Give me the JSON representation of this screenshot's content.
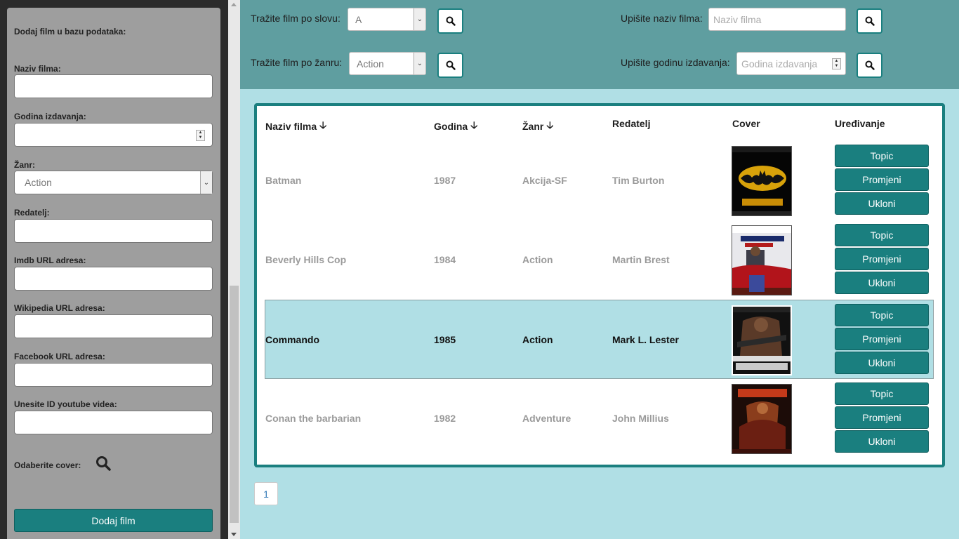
{
  "sidebar": {
    "title": "Dodaj film u bazu podataka:",
    "fields": [
      {
        "label": "Naziv filma:",
        "value": ""
      },
      {
        "label": "Godina izdavanja:",
        "value": ""
      },
      {
        "label": "Žanr:",
        "value": "Action"
      },
      {
        "label": "Redatelj:",
        "value": ""
      },
      {
        "label": "Imdb URL adresa:",
        "value": ""
      },
      {
        "label": "Wikipedia URL adresa:",
        "value": ""
      },
      {
        "label": "Facebook URL adresa:",
        "value": ""
      },
      {
        "label": "Unesite ID youtube videa:",
        "value": ""
      }
    ],
    "cover_label": "Odaberite cover:",
    "submit_label": "Dodaj film"
  },
  "search": {
    "by_letter_label": "Tražite film po slovu:",
    "by_letter_value": "A",
    "by_genre_label": "Tražite film po žanru:",
    "by_genre_value": "Action",
    "by_name_label": "Upišite naziv filma:",
    "by_name_placeholder": "Naziv filma",
    "by_year_label": "Upišite godinu izdavanja:",
    "by_year_placeholder": "Godina izdavanja"
  },
  "table": {
    "headers": [
      "Naziv filma",
      "Godina",
      "Žanr",
      "Redatelj",
      "Cover",
      "Uređivanje"
    ],
    "rows": [
      {
        "title": "Batman",
        "year": "1987",
        "genre": "Akcija-SF",
        "director": "Tim Burton"
      },
      {
        "title": "Beverly Hills Cop",
        "year": "1984",
        "genre": "Action",
        "director": "Martin Brest"
      },
      {
        "title": "Commando",
        "year": "1985",
        "genre": "Action",
        "director": "Mark L. Lester"
      },
      {
        "title": "Conan the barbarian",
        "year": "1982",
        "genre": "Adventure",
        "director": "John Millius"
      }
    ],
    "actions": {
      "topic": "Topic",
      "edit": "Promjeni",
      "remove": "Ukloni"
    }
  },
  "pagination": {
    "current": "1"
  },
  "colors": {
    "accent": "#1a7f7f",
    "header_bg": "#5f9ea0",
    "page_bg": "#b0dfe5",
    "sidebar_bg": "#9e9e9e"
  }
}
